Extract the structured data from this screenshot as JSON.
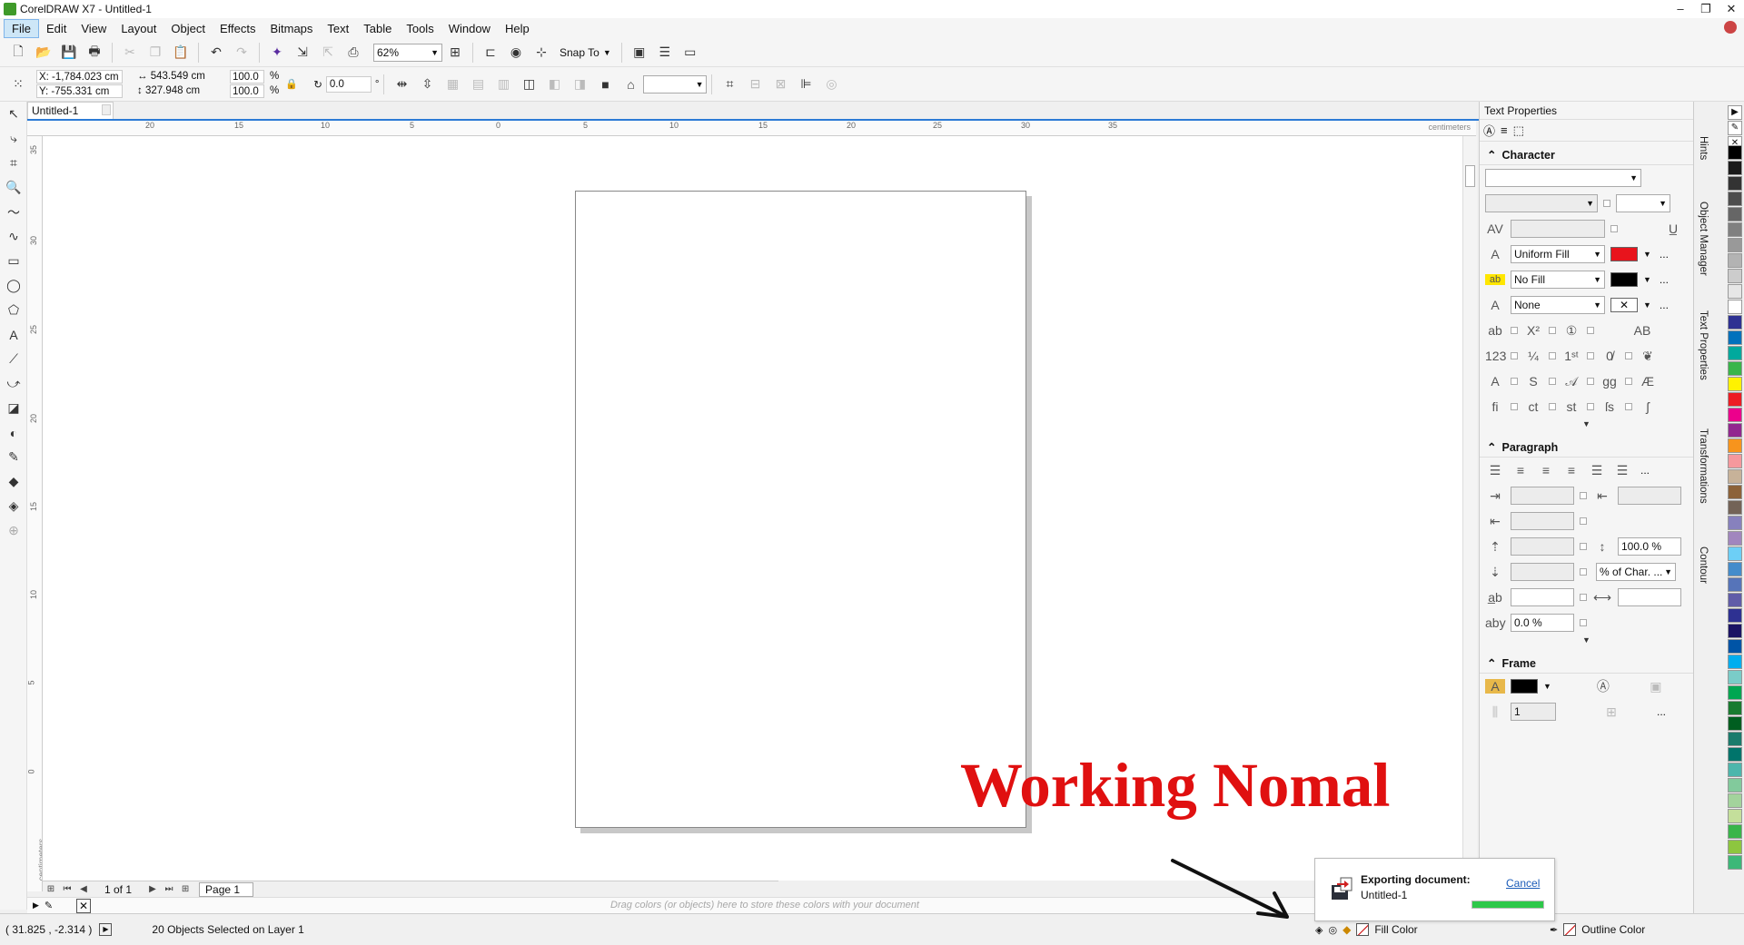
{
  "window": {
    "title": "CorelDRAW X7 - Untitled-1",
    "controls": [
      "–",
      "❐",
      "✕"
    ]
  },
  "menu": [
    "File",
    "Edit",
    "View",
    "Layout",
    "Object",
    "Effects",
    "Bitmaps",
    "Text",
    "Table",
    "Tools",
    "Window",
    "Help"
  ],
  "toolbar": {
    "zoom": "62%",
    "snap_to": "Snap To"
  },
  "propbar": {
    "x": "X: -1,784.023 cm",
    "y": "Y: -755.331 cm",
    "width": "543.549 cm",
    "height": "327.948 cm",
    "scale_x": "100.0",
    "scale_y": "100.0",
    "pct": "%",
    "angle": "0.0",
    "degree": "°"
  },
  "document": {
    "tab": "Untitled-1"
  },
  "ruler": {
    "h_ticks": [
      "20",
      "15",
      "10",
      "5",
      "0",
      "5",
      "10",
      "15",
      "20",
      "25",
      "30",
      "35"
    ],
    "v_ticks": [
      "35",
      "30",
      "25",
      "20",
      "15",
      "10",
      "5",
      "0"
    ],
    "unit": "centimeters"
  },
  "pagenav": {
    "count": "1 of 1",
    "page_tab": "Page 1"
  },
  "palette_hint": "Drag colors (or objects) here to store these colors with your document",
  "status": {
    "coords": "( 31.825 , -2.314 )",
    "selection": "20 Objects Selected on Layer 1",
    "fill_label": "Fill Color",
    "outline_label": "Outline Color"
  },
  "docker": {
    "title": "Text Properties",
    "character": {
      "heading": "Character",
      "fill_type": "Uniform Fill",
      "fill_color": "#e8141c",
      "bg_type": "No Fill",
      "bg_color": "#000000",
      "outline_type": "None"
    },
    "paragraph": {
      "heading": "Paragraph",
      "line_spacing": "100.0 %",
      "spacing_unit": "% of Char. ...",
      "char_spacing": "0.0 %"
    },
    "frame": {
      "heading": "Frame",
      "columns": "1"
    }
  },
  "side_tabs": [
    "Hints",
    "Object Manager",
    "Text Properties",
    "Transformations",
    "Contour"
  ],
  "palette_colors": [
    "#000000",
    "#1a1a1a",
    "#333333",
    "#4d4d4d",
    "#666666",
    "#808080",
    "#999999",
    "#b3b3b3",
    "#cccccc",
    "#e6e6e6",
    "#ffffff",
    "#2e3192",
    "#0071bc",
    "#00a99d",
    "#39b54a",
    "#fff200",
    "#ed1c24",
    "#ec008c",
    "#92278f",
    "#f7941d",
    "#f5989d",
    "#c7b299",
    "#8c6239",
    "#736357",
    "#8781bd",
    "#a186be",
    "#6dcff6",
    "#448ccb",
    "#5674b9",
    "#605ca8",
    "#2e3192",
    "#1b1464",
    "#0054a6",
    "#00aeef",
    "#7accc8",
    "#00a651",
    "#197b30",
    "#005e20",
    "#1a7b6c",
    "#00746b",
    "#4db6ac",
    "#82ca9c",
    "#a3d39c",
    "#c4df9b",
    "#39b54a",
    "#8dc63f",
    "#3cb878"
  ],
  "annotation": {
    "text": "Working Nomal"
  },
  "export": {
    "title": "Exporting document:",
    "file": "Untitled-1",
    "cancel": "Cancel",
    "progress": 1.0
  }
}
